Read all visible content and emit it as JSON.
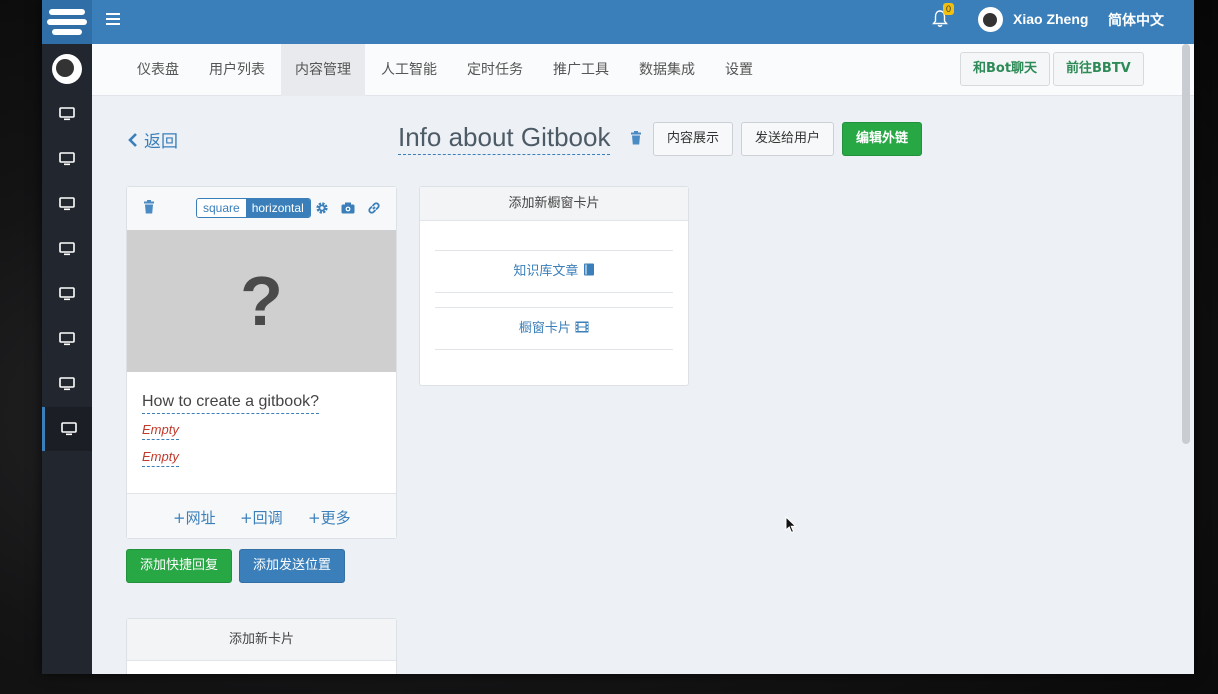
{
  "topbar": {
    "notification_count": "0",
    "user_name": "Xiao Zheng",
    "language": "简体中文"
  },
  "nav": {
    "tabs": [
      {
        "label": "仪表盘"
      },
      {
        "label": "用户列表"
      },
      {
        "label": "内容管理"
      },
      {
        "label": "人工智能"
      },
      {
        "label": "定时任务"
      },
      {
        "label": "推广工具"
      },
      {
        "label": "数据集成"
      },
      {
        "label": "设置"
      }
    ],
    "active_tab": "内容管理",
    "chat_bot_label": "和Bot聊天",
    "goto_bbtv_label": "前往BBTV"
  },
  "page": {
    "back_label": "返回",
    "title": "Info about Gitbook",
    "content_display_label": "内容展示",
    "send_to_user_label": "发送给用户",
    "edit_link_label": "编辑外链"
  },
  "card": {
    "toggle_square": "square",
    "toggle_horizontal": "horizontal",
    "toggle_selected": "horizontal",
    "image_placeholder": "?",
    "title": "How to create a gitbook?",
    "subtitle": "Empty",
    "description": "Empty",
    "footer_url": "+网址",
    "footer_callback": "+回调",
    "footer_more": "+更多"
  },
  "actions": {
    "add_quick_reply": "添加快捷回复",
    "add_send_location": "添加发送位置"
  },
  "panel": {
    "title": "添加新橱窗卡片",
    "item_knowledge": "知识库文章",
    "item_showcase": "橱窗卡片"
  },
  "bottom_card": {
    "title": "添加新卡片"
  },
  "colors": {
    "primary": "#3a7fba",
    "success": "#28a745",
    "sidebar": "#22262e",
    "danger_text": "#c0392b"
  }
}
